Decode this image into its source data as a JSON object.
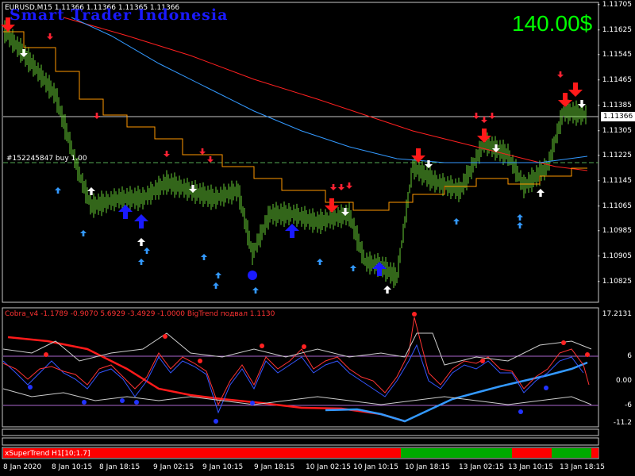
{
  "header": {
    "symbol_info": "EURUSD,M15  1.11366 1.11366 1.11365 1.11366",
    "watermark": "Smart Trader Indonesia",
    "profit": "140.00$",
    "profit_color": "#00ff00",
    "order_line": "#152245847 buy 1.00"
  },
  "price_axis": {
    "labels": [
      "1.11705",
      "1.11625",
      "1.11545",
      "1.11465",
      "1.11385",
      "1.11305",
      "1.11225",
      "1.11145",
      "1.11065",
      "1.10985",
      "1.10905",
      "1.10825"
    ],
    "current_price": "1.11366"
  },
  "indicator": {
    "title": "Cobra_v4 -1.1789 -0.9070 5.6929 -3.4929 -1.0000  BigTrend подвал 1.1130",
    "axis_labels": [
      "17.2131",
      "6",
      "0.00",
      "-6",
      "-11.2"
    ]
  },
  "supertrend": {
    "label": "xSuperTrend H1[10;1.7]",
    "up_color": "#00aa00",
    "down_color": "#ff0000"
  },
  "time_axis": {
    "labels": [
      "8 Jan 2020",
      "8 Jan 10:15",
      "8 Jan 18:15",
      "9 Jan 02:15",
      "9 Jan 10:15",
      "9 Jan 18:15",
      "10 Jan 02:15",
      "10 Jan 10:15",
      "10 Jan 18:15",
      "13 Jan 02:15",
      "13 Jan 10:15",
      "13 Jan 18:15"
    ]
  },
  "colors": {
    "candles": "#66cc33",
    "ma_red": "#ff2020",
    "ma_blue": "#3399ff",
    "stepline": "#ff9900",
    "arrow_up": "#3399ff",
    "arrow_down": "#ff2233"
  }
}
